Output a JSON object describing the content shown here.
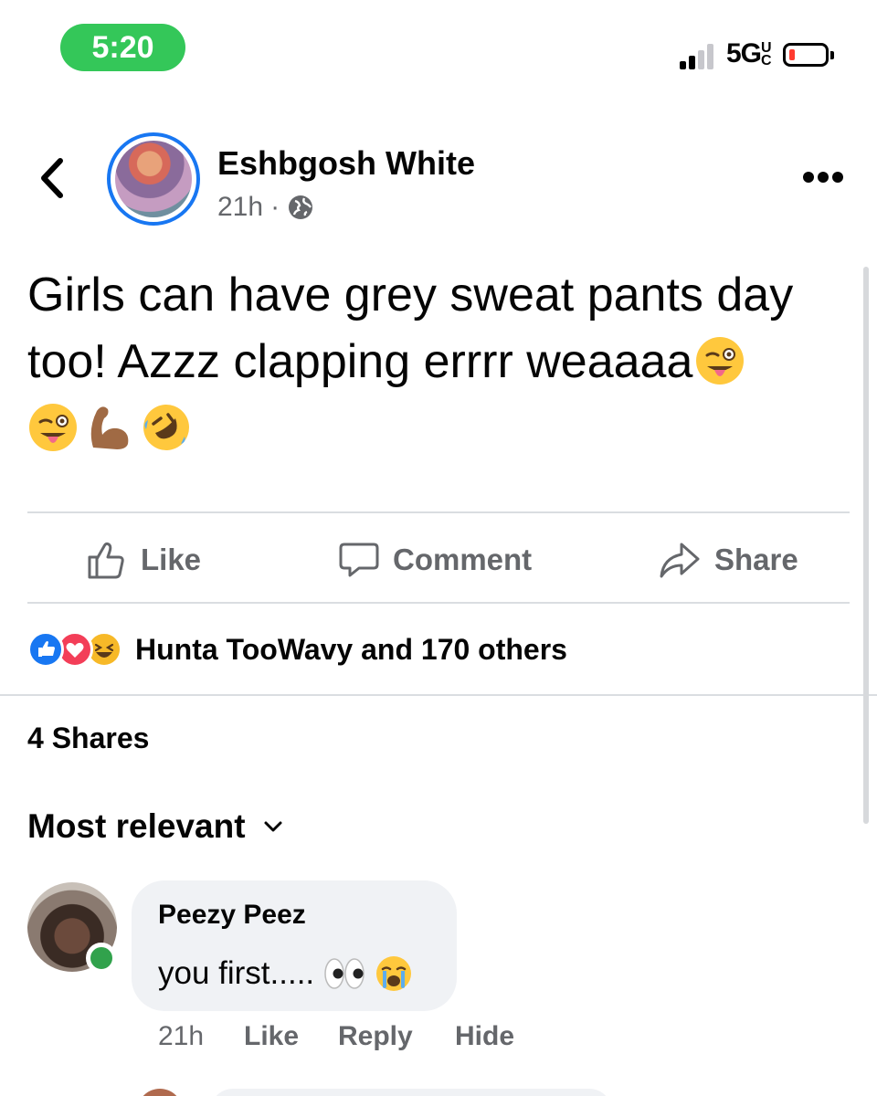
{
  "status_bar": {
    "time": "5:20",
    "network": "5G",
    "network_suffix": "UC",
    "battery_level": 0.1,
    "signal_bars_active": 2,
    "time_pill_color": "#34c759"
  },
  "post": {
    "author": "Eshbgosh White",
    "time": "21h",
    "separator": "·",
    "audience_icon": "globe-icon",
    "text": "Girls can have grey sweat pants day too! Azzz clapping errrr weaaaa",
    "text_trailing_emoji": "winking-tongue-emoji",
    "emoji_row": [
      "winking-tongue-emoji",
      "flexed-biceps-emoji",
      "rolling-laughing-emoji"
    ]
  },
  "actions": {
    "like": "Like",
    "comment": "Comment",
    "share": "Share"
  },
  "reactions": {
    "icons": [
      "like-reaction-icon",
      "love-reaction-icon",
      "haha-reaction-icon"
    ],
    "summary": "Hunta TooWavy and 170 others"
  },
  "shares_text": "4 Shares",
  "sort_label": "Most relevant",
  "comments": [
    {
      "name": "Peezy Peez",
      "text": "you first.....",
      "emojis": [
        "eyes-emoji",
        "crying-emoji"
      ],
      "time": "21h",
      "like_label": "Like",
      "reply_label": "Reply",
      "hide_label": "Hide",
      "online": true
    }
  ],
  "colors": {
    "accent": "#1877f2",
    "secondary_text": "#65676b",
    "bubble": "#f0f2f5",
    "online": "#31a24c"
  }
}
